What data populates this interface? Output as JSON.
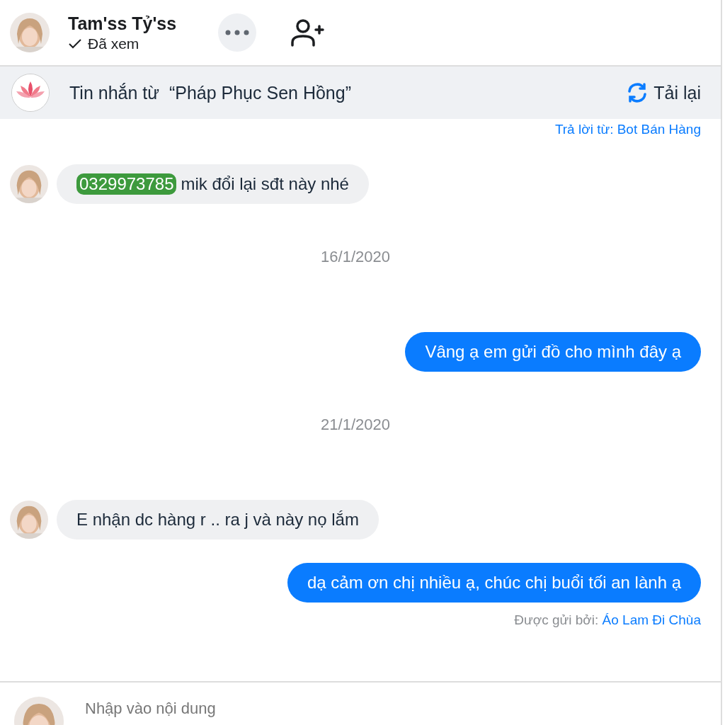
{
  "header": {
    "name": "Tam'ss Tỷ'ss",
    "status": "Đã xem"
  },
  "banner": {
    "text": "Tin nhắn từ  “Pháp Phục Sen Hồng”",
    "reload": "Tải lại"
  },
  "messages": [
    {
      "kind": "meta",
      "author": "Trả lời từ: Bot Bán Hàng"
    },
    {
      "kind": "incoming",
      "tag": "0329973785",
      "text": "mik đổi lại sđt này nhé"
    },
    {
      "kind": "date",
      "text": "16/1/2020"
    },
    {
      "kind": "outgoing",
      "text": "Vâng ạ em gửi đồ cho mình đây ạ"
    },
    {
      "kind": "date",
      "text": "21/1/2020"
    },
    {
      "kind": "incoming",
      "text": "E nhận dc hàng r .. ra j và này nọ lắm"
    },
    {
      "kind": "outgoing",
      "text": "dạ cảm ơn chị nhiều ạ, chúc chị buổi tối an lành ạ"
    },
    {
      "kind": "meta",
      "prefix": "Được gửi bởi:",
      "author": "Áo Lam Đi Chùa"
    }
  ],
  "composer": {
    "placeholder": "Nhập vào nội dung"
  }
}
